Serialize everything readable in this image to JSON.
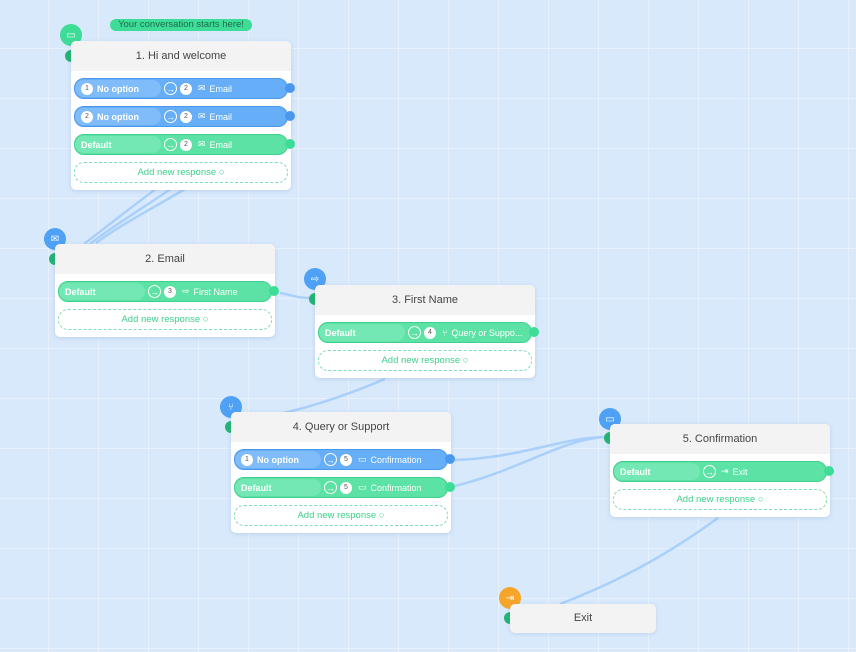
{
  "start_banner": "Your conversation starts here!",
  "add_response_label": "Add new response",
  "colors": {
    "blue": "#66aef7",
    "green": "#5de2a6",
    "start": "#3ddc97",
    "exit": "#f6a52b",
    "canvas": "#d9e9fc"
  },
  "nodes": [
    {
      "title": "1. Hi and welcome",
      "icon": "chat-bubble-icon",
      "responses": [
        {
          "num": "1",
          "label": "No option",
          "target_num": "2",
          "target_icon": "envelope-icon",
          "target": "Email",
          "color": "blue"
        },
        {
          "num": "2",
          "label": "No option",
          "target_num": "2",
          "target_icon": "envelope-icon",
          "target": "Email",
          "color": "blue"
        },
        {
          "num": "",
          "label": "Default",
          "target_num": "2",
          "target_icon": "envelope-icon",
          "target": "Email",
          "color": "green"
        }
      ]
    },
    {
      "title": "2. Email",
      "icon": "envelope-icon",
      "responses": [
        {
          "num": "",
          "label": "Default",
          "target_num": "3",
          "target_icon": "signpost-icon",
          "target": "First Name",
          "color": "green"
        }
      ]
    },
    {
      "title": "3. First Name",
      "icon": "signpost-icon",
      "responses": [
        {
          "num": "",
          "label": "Default",
          "target_num": "4",
          "target_icon": "branch-icon",
          "target": "Query or Suppo...",
          "color": "green"
        }
      ]
    },
    {
      "title": "4. Query or Support",
      "icon": "branch-icon",
      "responses": [
        {
          "num": "1",
          "label": "No option",
          "target_num": "5",
          "target_icon": "chat-check-icon",
          "target": "Confirmation",
          "color": "blue"
        },
        {
          "num": "",
          "label": "Default",
          "target_num": "5",
          "target_icon": "chat-check-icon",
          "target": "Confirmation",
          "color": "green"
        }
      ]
    },
    {
      "title": "5. Confirmation",
      "icon": "chat-check-icon",
      "responses": [
        {
          "num": "",
          "label": "Default",
          "target_num": "",
          "target_icon": "exit-door-icon",
          "target": "Exit",
          "color": "green"
        }
      ]
    }
  ],
  "exit_node": {
    "title": "Exit",
    "icon": "exit-door-icon"
  }
}
